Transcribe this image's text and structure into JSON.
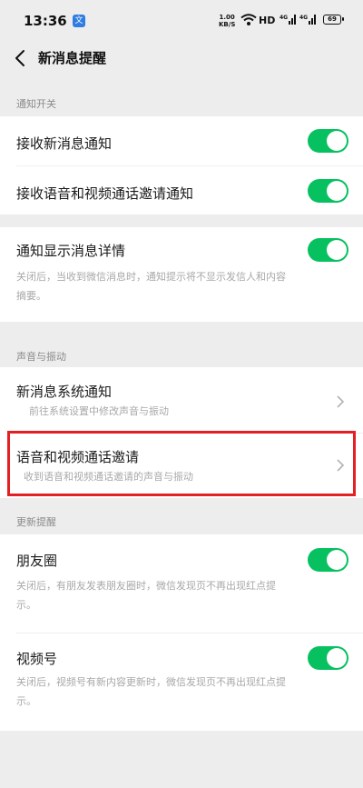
{
  "status_bar": {
    "time": "13:36",
    "app_badge": "文",
    "net_speed_value": "1.00",
    "net_speed_unit": "KB/S",
    "hd": "HD",
    "sig1": "4G",
    "sig2": "4G",
    "battery": "69"
  },
  "nav": {
    "title": "新消息提醒"
  },
  "sections": {
    "notify_switch": "通知开关",
    "sound_vibration": "声音与振动",
    "update_reminder": "更新提醒"
  },
  "rows": {
    "receive_new_msg": {
      "label": "接收新消息通知",
      "toggle_on": true
    },
    "receive_call_invite": {
      "label": "接收语音和视频通话邀请通知",
      "toggle_on": true
    },
    "show_detail": {
      "label": "通知显示消息详情",
      "toggle_on": true,
      "desc": "关闭后，当收到微信消息时，通知提示将不显示发信人和内容摘要。"
    },
    "system_notify": {
      "label": "新消息系统通知",
      "desc": "前往系统设置中修改声音与振动"
    },
    "call_invite": {
      "label": "语音和视频通话邀请",
      "desc": "收到语音和视频通话邀请的声音与振动"
    },
    "moments": {
      "label": "朋友圈",
      "toggle_on": true,
      "desc": "关闭后，有朋友发表朋友圈时，微信发现页不再出现红点提示。"
    },
    "channels": {
      "label": "视频号",
      "toggle_on": true,
      "desc": "关闭后，视频号有新内容更新时，微信发现页不再出现红点提示。"
    }
  },
  "colors": {
    "toggle_on": "#07c160",
    "highlight": "#e31f22",
    "background": "#ededed"
  }
}
